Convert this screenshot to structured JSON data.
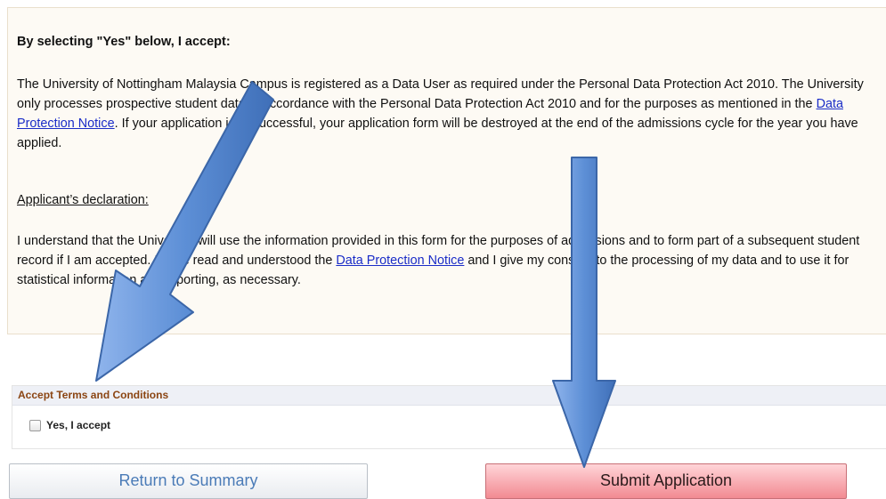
{
  "notice": {
    "heading": "By selecting \"Yes\" below, I accept:",
    "para1_text1": "The University of Nottingham Malaysia Campus is registered as a Data User as required under the Personal Data Protection Act 2010. The University only processes prospective student data in accordance with the Personal Data Protection Act 2010 and for the purposes as mentioned in the ",
    "para1_link": "Data Protection Notice",
    "para1_text2": ". If your application is unsuccessful, your application form will be destroyed at the end of the admissions cycle for the year you have applied.",
    "declaration_label": "Applicant’s declaration:",
    "para2_text1": "I understand that the University will use the information provided in this form for the purposes of admissions and to form part of a subsequent student record if I am accepted. I have read and understood the ",
    "para2_link": "Data Protection Notice",
    "para2_text2": " and I give my consent to the processing of my data and to use it for statistical information and reporting, as necessary."
  },
  "accept": {
    "header": "Accept Terms and Conditions",
    "checkbox_label": "Yes, I accept",
    "checked": false
  },
  "buttons": {
    "return": "Return to Summary",
    "submit": "Submit Application"
  },
  "colors": {
    "panel_bg": "#fdfaf4",
    "link": "#1a2cc7",
    "accept_header_text": "#8b4513",
    "submit_bg": "#f28a92",
    "arrow_fill": "#5d8fd6"
  },
  "icons": [
    "arrow-annotation-icon"
  ]
}
